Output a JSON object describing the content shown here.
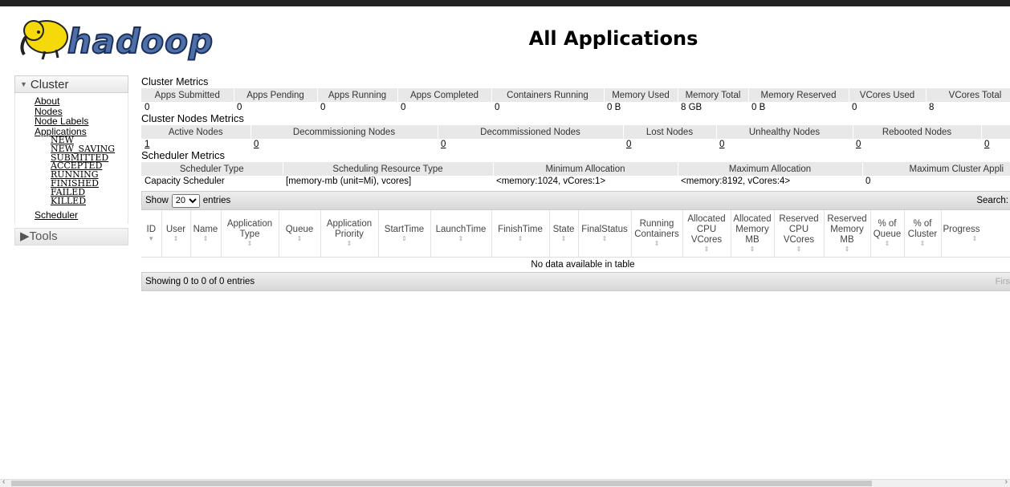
{
  "header": {
    "logo_text": "hadoop",
    "title": "All Applications"
  },
  "sidebar": {
    "cluster_label": "Cluster",
    "items": [
      "About",
      "Nodes",
      "Node Labels",
      "Applications"
    ],
    "app_states": [
      "NEW",
      "NEW_SAVING",
      "SUBMITTED",
      "ACCEPTED",
      "RUNNING",
      "FINISHED",
      "FAILED",
      "KILLED"
    ],
    "scheduler": "Scheduler",
    "tools_label": "Tools"
  },
  "cluster_metrics": {
    "title": "Cluster Metrics",
    "headers": [
      "Apps Submitted",
      "Apps Pending",
      "Apps Running",
      "Apps Completed",
      "Containers Running",
      "Memory Used",
      "Memory Total",
      "Memory Reserved",
      "VCores Used",
      "VCores Total"
    ],
    "values": [
      "0",
      "0",
      "0",
      "0",
      "0",
      "0 B",
      "8 GB",
      "0 B",
      "0",
      "8"
    ]
  },
  "nodes_metrics": {
    "title": "Cluster Nodes Metrics",
    "headers": [
      "Active Nodes",
      "Decommissioning Nodes",
      "Decommissioned Nodes",
      "Lost Nodes",
      "Unhealthy Nodes",
      "Rebooted Nodes",
      ""
    ],
    "values": [
      "1",
      "0",
      "0",
      "0",
      "0",
      "0",
      "0"
    ]
  },
  "scheduler_metrics": {
    "title": "Scheduler Metrics",
    "headers": [
      "Scheduler Type",
      "Scheduling Resource Type",
      "Minimum Allocation",
      "Maximum Allocation",
      "Maximum Cluster Appli"
    ],
    "values": [
      "Capacity Scheduler",
      "[memory-mb (unit=Mi), vcores]",
      "<memory:1024, vCores:1>",
      "<memory:8192, vCores:4>",
      "0"
    ]
  },
  "apps_table": {
    "show_label": "Show",
    "entries_label": "entries",
    "page_size": "20",
    "search_label": "Search:",
    "columns": [
      "ID",
      "User",
      "Name",
      "Application Type",
      "Queue",
      "Application Priority",
      "StartTime",
      "LaunchTime",
      "FinishTime",
      "State",
      "FinalStatus",
      "Running Containers",
      "Allocated CPU VCores",
      "Allocated Memory MB",
      "Reserved CPU VCores",
      "Reserved Memory MB",
      "% of Queue",
      "% of Cluster",
      "Progress"
    ],
    "empty_text": "No data available in table",
    "info_text": "Showing 0 to 0 of 0 entries",
    "first_label": "First"
  },
  "colors": {
    "header_bg": "#e8e8e8",
    "topbar": "#222222"
  }
}
